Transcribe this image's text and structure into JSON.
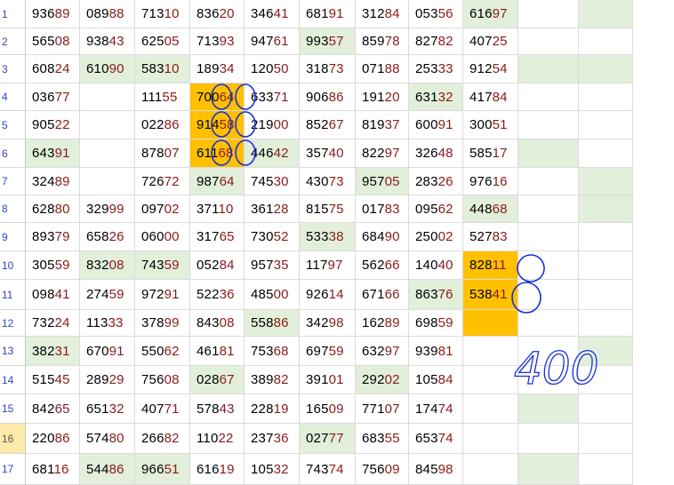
{
  "sheet": {
    "rows": [
      {
        "num": "1",
        "cells": [
          "93689",
          "08988",
          "71310",
          "83620",
          "34641",
          "68191",
          "31284",
          "05356",
          "61697",
          "",
          ""
        ]
      },
      {
        "num": "2",
        "cells": [
          "56508",
          "93843",
          "62505",
          "71393",
          "94761",
          "99357",
          "85978",
          "82782",
          "40725",
          "",
          ""
        ]
      },
      {
        "num": "3",
        "cells": [
          "60824",
          "61090",
          "58310",
          "18934",
          "12050",
          "31873",
          "07188",
          "25333",
          "91254",
          "",
          ""
        ]
      },
      {
        "num": "4",
        "cells": [
          "03677",
          "",
          "11155",
          "70064",
          "63371",
          "90686",
          "19120",
          "63132",
          "41784",
          "",
          ""
        ]
      },
      {
        "num": "5",
        "cells": [
          "90522",
          "",
          "02286",
          "91458",
          "21900",
          "85267",
          "81937",
          "60091",
          "30051",
          "",
          ""
        ]
      },
      {
        "num": "6",
        "cells": [
          "64391",
          "",
          "87807",
          "61168",
          "44642",
          "35740",
          "82297",
          "32648",
          "58517",
          "",
          ""
        ]
      },
      {
        "num": "7",
        "cells": [
          "32489",
          "",
          "72672",
          "98764",
          "74530",
          "43073",
          "95705",
          "28326",
          "97616",
          "",
          ""
        ]
      },
      {
        "num": "8",
        "cells": [
          "62880",
          "32999",
          "09702",
          "37110",
          "36128",
          "81575",
          "01783",
          "09562",
          "44868",
          "",
          ""
        ]
      },
      {
        "num": "9",
        "cells": [
          "89379",
          "65826",
          "06000",
          "31765",
          "73052",
          "53338",
          "68490",
          "25002",
          "52783",
          "",
          ""
        ]
      },
      {
        "num": "10",
        "cells": [
          "30559",
          "83208",
          "74359",
          "05284",
          "95735",
          "11797",
          "56266",
          "14040",
          "82811",
          "",
          ""
        ]
      },
      {
        "num": "11",
        "cells": [
          "09841",
          "27459",
          "97291",
          "52236",
          "48500",
          "92614",
          "67166",
          "86376",
          "53841",
          "",
          ""
        ]
      },
      {
        "num": "12",
        "cells": [
          "73224",
          "11333",
          "37899",
          "84308",
          "55886",
          "34298",
          "16289",
          "69859",
          "",
          "",
          ""
        ]
      },
      {
        "num": "13",
        "cells": [
          "38231",
          "67091",
          "55062",
          "46181",
          "75368",
          "69759",
          "63297",
          "93981",
          "",
          "",
          ""
        ]
      },
      {
        "num": "14",
        "cells": [
          "51545",
          "28929",
          "75608",
          "02867",
          "38982",
          "39101",
          "29202",
          "10584",
          "",
          "",
          ""
        ]
      },
      {
        "num": "15",
        "cells": [
          "84265",
          "65132",
          "40771",
          "57843",
          "22819",
          "16509",
          "77107",
          "17474",
          "",
          "",
          ""
        ]
      },
      {
        "num": "16",
        "cells": [
          "22086",
          "57480",
          "26682",
          "11022",
          "23736",
          "02777",
          "68355",
          "65374",
          "",
          "",
          ""
        ]
      },
      {
        "num": "17",
        "cells": [
          "68116",
          "54486",
          "96651",
          "61619",
          "10532",
          "74374",
          "75609",
          "84598",
          "",
          "",
          ""
        ]
      }
    ],
    "selected_row": "16",
    "annotation_text": "400",
    "colors": {
      "green": "#e2efda",
      "orange": "#ffc000",
      "ink": "#1a2fd8",
      "low_digits": "#8b1a1a"
    }
  }
}
